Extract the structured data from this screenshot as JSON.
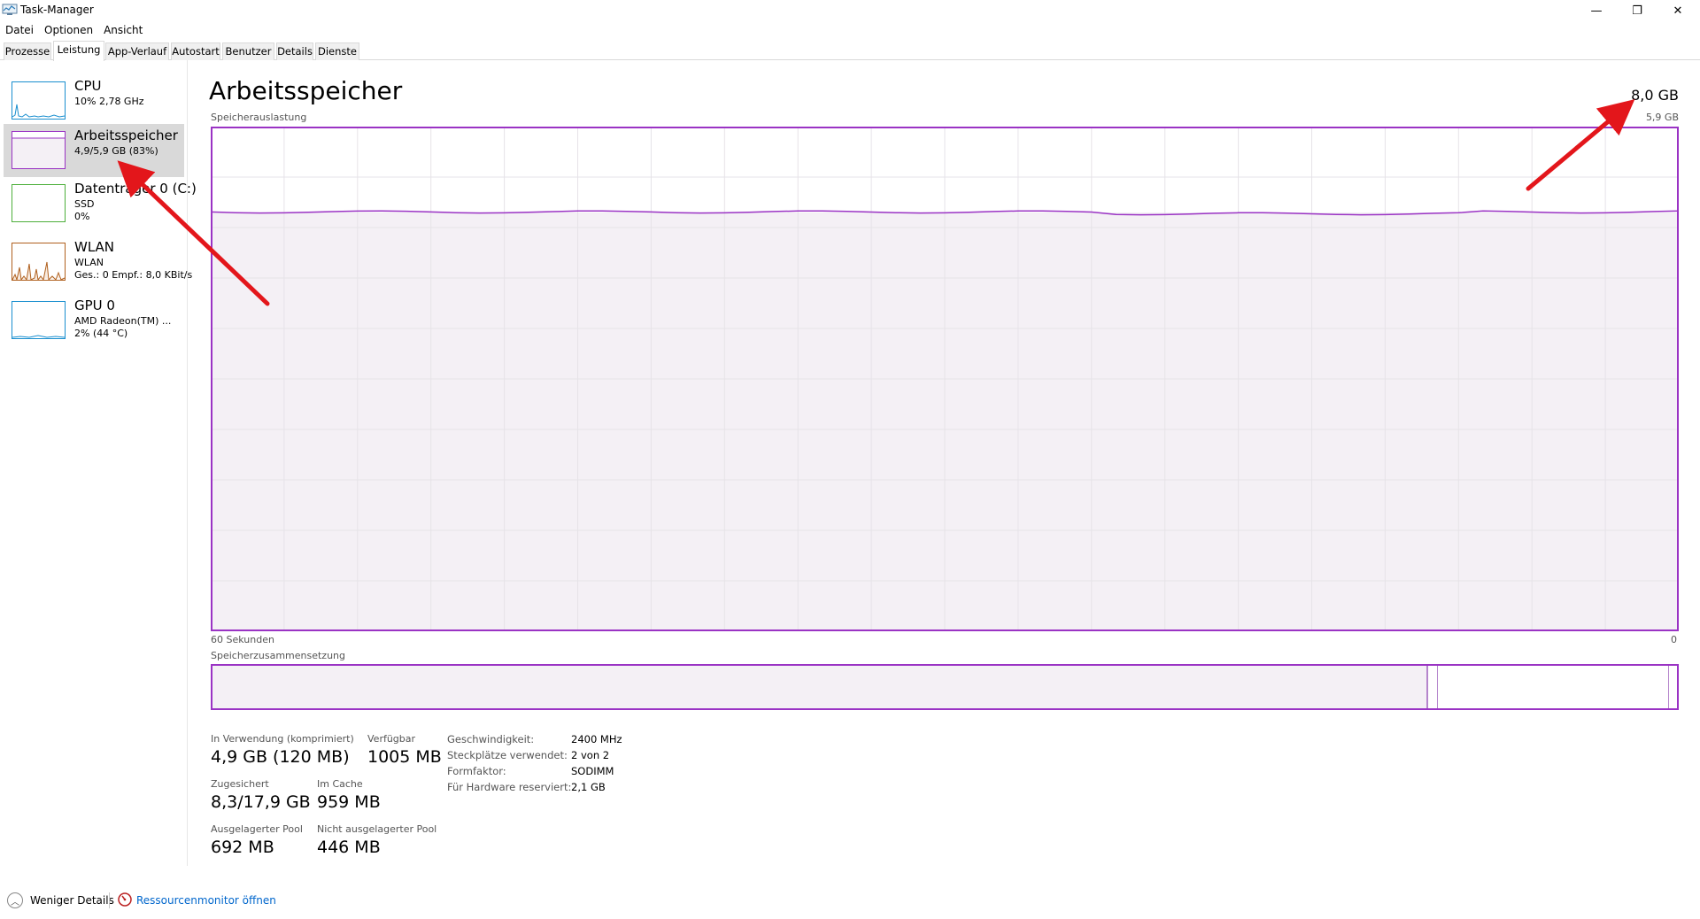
{
  "window": {
    "title": "Task-Manager",
    "minimize_glyph": "—",
    "restore_glyph": "❐",
    "close_glyph": "✕"
  },
  "menu": [
    "Datei",
    "Optionen",
    "Ansicht"
  ],
  "tabs": [
    "Prozesse",
    "Leistung",
    "App-Verlauf",
    "Autostart",
    "Benutzer",
    "Details",
    "Dienste"
  ],
  "active_tab": "Leistung",
  "sidebar": {
    "items": [
      {
        "title": "CPU",
        "lines": [
          "10%  2,78 GHz"
        ],
        "color": "#1a8fcf"
      },
      {
        "title": "Arbeitsspeicher",
        "lines": [
          "4,9/5,9 GB (83%)"
        ],
        "color": "#9a33c4",
        "selected": true
      },
      {
        "title": "Datenträger 0 (C:)",
        "lines": [
          "SSD",
          "0%"
        ],
        "color": "#4daf3b"
      },
      {
        "title": "WLAN",
        "lines": [
          "WLAN",
          "Ges.: 0  Empf.: 8,0 KBit/s"
        ],
        "color": "#b0601e"
      },
      {
        "title": "GPU 0",
        "lines": [
          "AMD Radeon(TM) ...",
          "2% (44 °C)"
        ],
        "color": "#1a8fcf"
      }
    ]
  },
  "main": {
    "title": "Arbeitsspeicher",
    "capacity": "8,0 GB",
    "graph_label": "Speicherauslastung",
    "graph_max": "5,9 GB",
    "graph_time_left": "60 Sekunden",
    "graph_time_right": "0",
    "composition_label": "Speicherzusammensetzung",
    "usage_fraction": 0.83,
    "composition_used_fraction": 0.83,
    "accent_color": "#9a33c4"
  },
  "stats": {
    "in_use_label": "In Verwendung (komprimiert)",
    "in_use_value": "4,9 GB (120 MB)",
    "available_label": "Verfügbar",
    "available_value": "1005 MB",
    "committed_label": "Zugesichert",
    "committed_value": "8,3/17,9 GB",
    "cached_label": "Im Cache",
    "cached_value": "959 MB",
    "paged_label": "Ausgelagerter Pool",
    "paged_value": "692 MB",
    "nonpaged_label": "Nicht ausgelagerter Pool",
    "nonpaged_value": "446 MB"
  },
  "hardware": [
    {
      "key": "Geschwindigkeit:",
      "value": "2400 MHz"
    },
    {
      "key": "Steckplätze verwendet:",
      "value": "2 von 2"
    },
    {
      "key": "Formfaktor:",
      "value": "SODIMM"
    },
    {
      "key": "Für Hardware reserviert:",
      "value": "2,1 GB"
    }
  ],
  "footer": {
    "fewer_details": "Weniger Details",
    "resource_monitor": "Ressourcenmonitor öffnen"
  }
}
